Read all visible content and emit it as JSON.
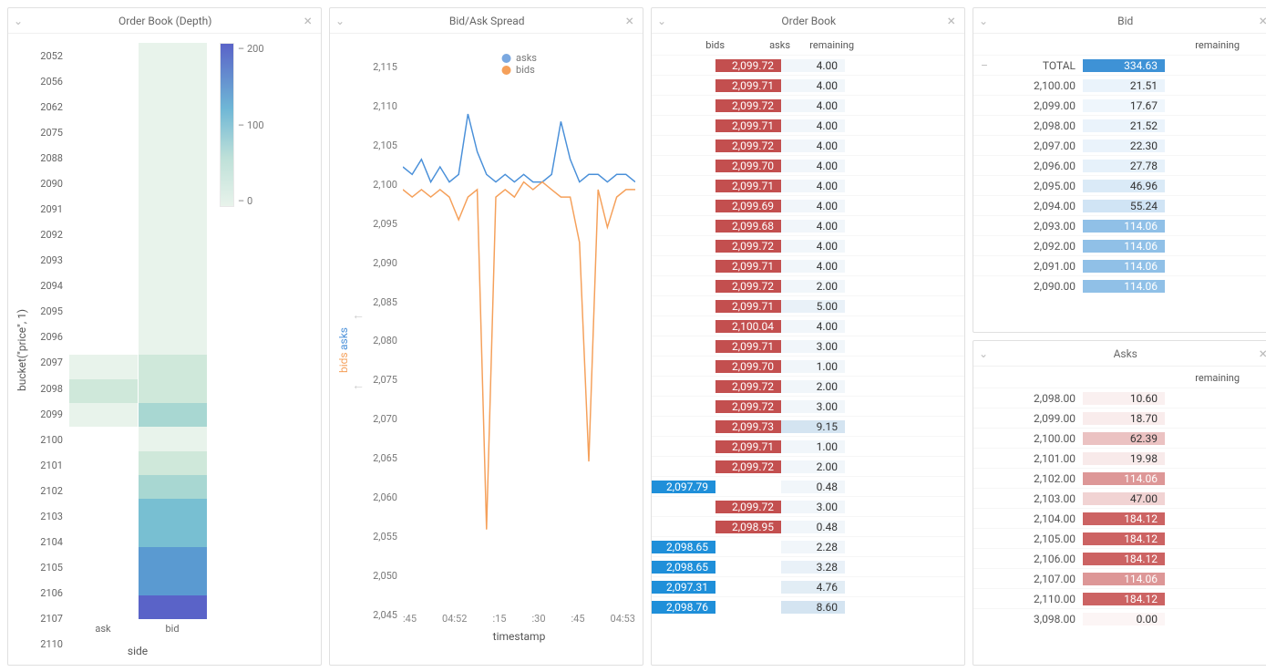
{
  "panels": {
    "depth": {
      "title": "Order Book (Depth)",
      "xlabel": "side",
      "ylabel": "bucket(\"price\", 1)",
      "xticks": [
        "ask",
        "bid"
      ]
    },
    "spread": {
      "title": "Bid/Ask Spread",
      "xlabel": "timestamp",
      "legend": {
        "asks": "asks",
        "bids": "bids"
      },
      "ylabels": {
        "asks": "asks",
        "bids": "bids"
      }
    },
    "orderbook": {
      "title": "Order Book",
      "headers": {
        "bids": "bids",
        "asks": "asks",
        "remaining": "remaining"
      }
    },
    "bid": {
      "title": "Bid",
      "headers": {
        "remaining": "remaining"
      },
      "total_label": "TOTAL"
    },
    "asks": {
      "title": "Asks",
      "headers": {
        "remaining": "remaining"
      }
    }
  },
  "chart_data": {
    "depth_heatmap": {
      "type": "heatmap",
      "ylabel": "bucket(\"price\", 1)",
      "xlabel": "side",
      "x_categories": [
        "ask",
        "bid"
      ],
      "y_buckets": [
        2052,
        2056,
        2062,
        2075,
        2088,
        2090,
        2091,
        2092,
        2093,
        2094,
        2095,
        2096,
        2097,
        2098,
        2099,
        2100,
        2101,
        2102,
        2103,
        2104,
        2105,
        2106,
        2107,
        2110
      ],
      "legend_ticks": [
        200,
        100,
        0
      ],
      "values": {
        "ask": [
          0,
          0,
          0,
          0,
          0,
          0,
          0,
          0,
          0,
          0,
          0,
          0,
          0,
          18,
          40,
          10,
          0,
          0,
          0,
          0,
          0,
          0,
          0,
          0
        ],
        "bid": [
          5,
          5,
          5,
          5,
          5,
          5,
          5,
          5,
          5,
          5,
          5,
          5,
          5,
          25,
          45,
          60,
          20,
          50,
          100,
          120,
          140,
          160,
          180,
          230
        ]
      }
    },
    "spread_chart": {
      "type": "line",
      "xlabel": "timestamp",
      "ylim": [
        2045,
        2115
      ],
      "yticks": [
        2115,
        2110,
        2105,
        2100,
        2095,
        2090,
        2085,
        2080,
        2075,
        2070,
        2065,
        2060,
        2055,
        2050,
        2045
      ],
      "xticks": [
        ":45",
        "04:52",
        ":15",
        ":30",
        ":45",
        "04:53"
      ],
      "series": [
        {
          "name": "asks",
          "color": "#4a90d9",
          "y": [
            2101,
            2100,
            2102,
            2099,
            2101,
            2099,
            2100,
            2108,
            2103,
            2100,
            2099,
            2100,
            2099,
            2100,
            2099,
            2099,
            2100,
            2107,
            2102,
            2099,
            2100,
            2100,
            2099,
            2100,
            2100,
            2099
          ]
        },
        {
          "name": "bids",
          "color": "#f5a05a",
          "y": [
            2098,
            2097,
            2098,
            2097,
            2098,
            2097,
            2094,
            2097,
            2098,
            2053,
            2097,
            2098,
            2097,
            2099,
            2098,
            2099,
            2098,
            2097,
            2097,
            2091,
            2062,
            2098,
            2093,
            2097,
            2098,
            2098
          ]
        }
      ]
    }
  },
  "orderbook_rows": [
    {
      "bid": "",
      "ask": "2,099.72",
      "rem": "4.00",
      "rshade": 0
    },
    {
      "bid": "",
      "ask": "2,099.71",
      "rem": "4.00",
      "rshade": 0
    },
    {
      "bid": "",
      "ask": "2,099.72",
      "rem": "4.00",
      "rshade": 0
    },
    {
      "bid": "",
      "ask": "2,099.71",
      "rem": "4.00",
      "rshade": 0
    },
    {
      "bid": "",
      "ask": "2,099.72",
      "rem": "4.00",
      "rshade": 0
    },
    {
      "bid": "",
      "ask": "2,099.70",
      "rem": "4.00",
      "rshade": 0
    },
    {
      "bid": "",
      "ask": "2,099.71",
      "rem": "4.00",
      "rshade": 0
    },
    {
      "bid": "",
      "ask": "2,099.69",
      "rem": "4.00",
      "rshade": 0
    },
    {
      "bid": "",
      "ask": "2,099.68",
      "rem": "4.00",
      "rshade": 0
    },
    {
      "bid": "",
      "ask": "2,099.72",
      "rem": "4.00",
      "rshade": 0
    },
    {
      "bid": "",
      "ask": "2,099.71",
      "rem": "4.00",
      "rshade": 0
    },
    {
      "bid": "",
      "ask": "2,099.72",
      "rem": "2.00",
      "rshade": 0
    },
    {
      "bid": "",
      "ask": "2,099.71",
      "rem": "5.00",
      "rshade": 10
    },
    {
      "bid": "",
      "ask": "2,100.04",
      "rem": "4.00",
      "rshade": 0
    },
    {
      "bid": "",
      "ask": "2,099.71",
      "rem": "3.00",
      "rshade": 0
    },
    {
      "bid": "",
      "ask": "2,099.70",
      "rem": "1.00",
      "rshade": 0
    },
    {
      "bid": "",
      "ask": "2,099.72",
      "rem": "2.00",
      "rshade": 0
    },
    {
      "bid": "",
      "ask": "2,099.72",
      "rem": "3.00",
      "rshade": 0
    },
    {
      "bid": "",
      "ask": "2,099.73",
      "rem": "9.15",
      "rshade": 40
    },
    {
      "bid": "",
      "ask": "2,099.71",
      "rem": "1.00",
      "rshade": 0
    },
    {
      "bid": "",
      "ask": "2,099.72",
      "rem": "2.00",
      "rshade": 0
    },
    {
      "bid": "2,097.79",
      "ask": "",
      "rem": "0.48",
      "rshade": 0
    },
    {
      "bid": "",
      "ask": "2,099.72",
      "rem": "3.00",
      "rshade": 0
    },
    {
      "bid": "",
      "ask": "2,098.95",
      "rem": "0.48",
      "rshade": 0
    },
    {
      "bid": "2,098.65",
      "ask": "",
      "rem": "2.28",
      "rshade": 0
    },
    {
      "bid": "2,098.65",
      "ask": "",
      "rem": "3.28",
      "rshade": 10
    },
    {
      "bid": "2,097.31",
      "ask": "",
      "rem": "4.76",
      "rshade": 20
    },
    {
      "bid": "2,098.76",
      "ask": "",
      "rem": "8.60",
      "rshade": 40
    }
  ],
  "bid_total": {
    "price": "TOTAL",
    "rem": "334.63",
    "shade": 100
  },
  "bid_rows": [
    {
      "price": "2,100.00",
      "rem": "21.51",
      "shade": 5
    },
    {
      "price": "2,099.00",
      "rem": "17.67",
      "shade": 3
    },
    {
      "price": "2,098.00",
      "rem": "21.52",
      "shade": 5
    },
    {
      "price": "2,097.00",
      "rem": "22.30",
      "shade": 6
    },
    {
      "price": "2,096.00",
      "rem": "27.78",
      "shade": 8
    },
    {
      "price": "2,095.00",
      "rem": "46.96",
      "shade": 15
    },
    {
      "price": "2,094.00",
      "rem": "55.24",
      "shade": 20
    },
    {
      "price": "2,093.00",
      "rem": "114.06",
      "shade": 55
    },
    {
      "price": "2,092.00",
      "rem": "114.06",
      "shade": 55
    },
    {
      "price": "2,091.00",
      "rem": "114.06",
      "shade": 55
    },
    {
      "price": "2,090.00",
      "rem": "114.06",
      "shade": 55
    }
  ],
  "asks_rows": [
    {
      "price": "2,098.00",
      "rem": "10.60",
      "shade": 3
    },
    {
      "price": "2,099.00",
      "rem": "18.70",
      "shade": 6
    },
    {
      "price": "2,100.00",
      "rem": "62.39",
      "shade": 30
    },
    {
      "price": "2,101.00",
      "rem": "19.98",
      "shade": 7
    },
    {
      "price": "2,102.00",
      "rem": "114.06",
      "shade": 55
    },
    {
      "price": "2,103.00",
      "rem": "47.00",
      "shade": 20
    },
    {
      "price": "2,104.00",
      "rem": "184.12",
      "shade": 85
    },
    {
      "price": "2,105.00",
      "rem": "184.12",
      "shade": 85
    },
    {
      "price": "2,106.00",
      "rem": "184.12",
      "shade": 85
    },
    {
      "price": "2,107.00",
      "rem": "114.06",
      "shade": 55
    },
    {
      "price": "2,110.00",
      "rem": "184.12",
      "shade": 85
    },
    {
      "price": "3,098.00",
      "rem": "0.00",
      "shade": 0
    }
  ]
}
